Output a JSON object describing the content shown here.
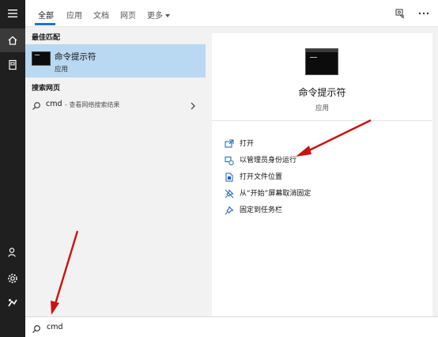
{
  "tabs": {
    "all": "全部",
    "apps": "应用",
    "documents": "文档",
    "web": "网页",
    "more": "更多"
  },
  "results": {
    "best_match_label": "最佳匹配",
    "best_match": {
      "title": "命令提示符",
      "subtitle": "应用"
    },
    "web_search_label": "搜索网页",
    "web_item": {
      "term": "cmd",
      "hint": "- 查看网络搜索结果"
    }
  },
  "detail": {
    "title": "命令提示符",
    "subtitle": "应用",
    "actions": [
      {
        "label": "打开",
        "icon": "open-icon"
      },
      {
        "label": "以管理员身份运行",
        "icon": "run-as-admin-icon"
      },
      {
        "label": "打开文件位置",
        "icon": "file-location-icon"
      },
      {
        "label": "从“开始”屏幕取消固定",
        "icon": "unpin-icon"
      },
      {
        "label": "固定到任务栏",
        "icon": "pin-taskbar-icon"
      }
    ]
  },
  "search": {
    "value": "cmd"
  },
  "rail_icons": [
    "hamburger-icon",
    "home-icon",
    "documents-icon",
    "user-icon",
    "settings-icon",
    "photos-icon"
  ],
  "colors": {
    "accent": "#1a73d4",
    "selection": "#b9d8f1",
    "rail": "#1f1f1f",
    "annotation_arrow": "#cc1111"
  }
}
